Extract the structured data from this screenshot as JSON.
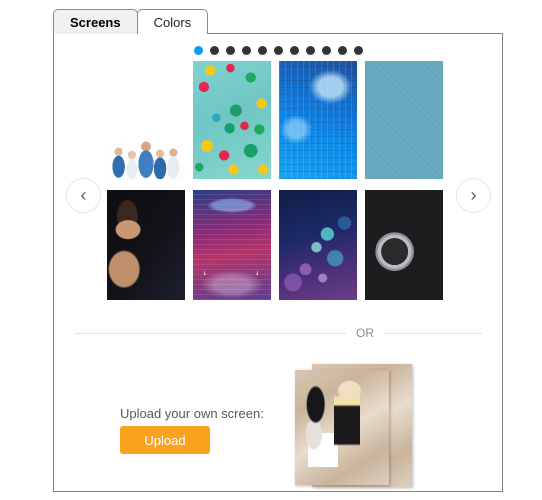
{
  "tabs": [
    {
      "id": "screens",
      "label": "Screens",
      "active": true
    },
    {
      "id": "colors",
      "label": "Colors",
      "active": false
    }
  ],
  "carousel": {
    "prev_icon": "chevron-left-icon",
    "next_icon": "chevron-right-icon",
    "prev_glyph": "‹",
    "next_glyph": "›",
    "dot_count": 11,
    "active_dot_index": 0,
    "active_dot_color": "#0a9bf5",
    "inactive_dot_color": "#333333"
  },
  "thumbnails": {
    "row1": [
      {
        "id": "screen-medical-team",
        "alt": "Medical team in scrubs on white background",
        "art": "art-medical"
      },
      {
        "id": "screen-balloons",
        "alt": "Colorful balloons against teal sky",
        "art": "art-balloons"
      },
      {
        "id": "screen-circuit-board",
        "alt": "Blue electronic circuit board close-up",
        "art": "art-circuit"
      },
      {
        "id": "screen-teal-texture",
        "alt": "Flat teal blue texture",
        "art": "art-flat-teal"
      }
    ],
    "row2": [
      {
        "id": "screen-portrait",
        "alt": "Fashion portrait on dark background",
        "art": "art-portrait"
      },
      {
        "id": "screen-concert-stage",
        "alt": "Concert stage with pink and blue lights",
        "art": "art-concert"
      },
      {
        "id": "screen-bokeh-lights",
        "alt": "Blue and purple bokeh lights",
        "art": "art-bokeh"
      },
      {
        "id": "screen-car-wheel",
        "alt": "Alloy wheel of a red sports car",
        "art": "art-car"
      }
    ]
  },
  "divider": {
    "text": "OR"
  },
  "upload": {
    "label": "Upload your own screen:",
    "button_label": "Upload",
    "button_color": "#faa21b"
  },
  "preview": {
    "back_alt": "Women shopping — preview thumbnail, back layer",
    "front_alt": "Women shopping — preview thumbnail, front layer"
  }
}
